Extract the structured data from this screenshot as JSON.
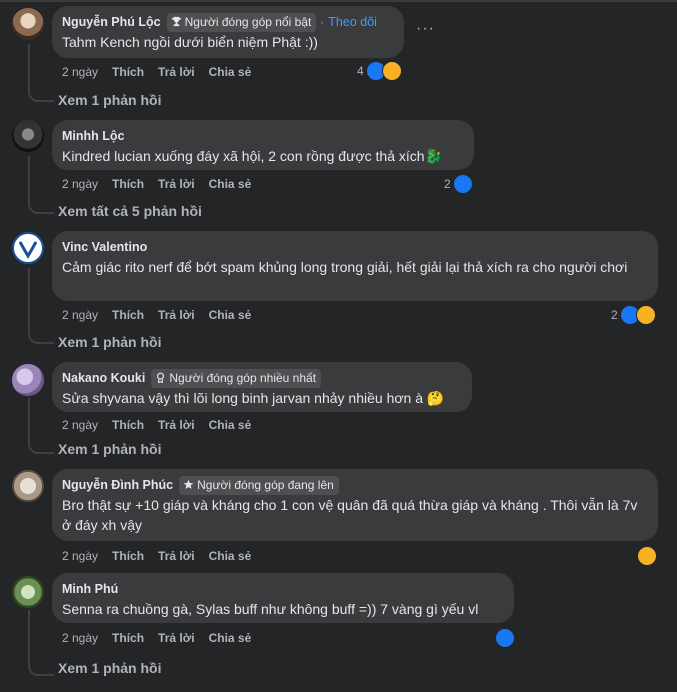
{
  "comments": [
    {
      "name": "Nguyễn Phú Lộc",
      "badge": "Người đóng góp nổi bật",
      "follow": "Theo dõi",
      "text": "Tahm Kench ngồi dưới biển niệm Phật :))",
      "time": "2 ngày",
      "like": "Thích",
      "reply": "Trả lời",
      "share": "Chia sẻ",
      "reaction_count": "4",
      "reactions": [
        "like",
        "haha"
      ],
      "replies": "Xem 1 phản hồi"
    },
    {
      "name": "Minhh Lộc",
      "text": "Kindred lucian xuống đáy xã hội, 2 con rồng được thả xích🐉",
      "time": "2 ngày",
      "like": "Thích",
      "reply": "Trả lời",
      "share": "Chia sẻ",
      "reaction_count": "2",
      "reactions": [
        "like"
      ],
      "replies": "Xem tất cả 5 phản hồi"
    },
    {
      "name": "Vinc Valentino",
      "text": "Cảm giác rito nerf để bớt spam khủng long trong giải, hết giải lại thả xích ra cho người chơi",
      "time": "2 ngày",
      "like": "Thích",
      "reply": "Trả lời",
      "share": "Chia sẻ",
      "reaction_count": "2",
      "reactions": [
        "like",
        "haha"
      ],
      "replies": "Xem 1 phản hồi"
    },
    {
      "name": "Nakano Kouki",
      "badge": "Người đóng góp nhiều nhất",
      "text": "Sửa shyvana vậy thì lõi long binh jarvan nhảy nhiều hơn à 🤔",
      "time": "2 ngày",
      "like": "Thích",
      "reply": "Trả lời",
      "share": "Chia sẻ",
      "replies": "Xem 1 phản hồi"
    },
    {
      "name": "Nguyễn Đình Phúc",
      "badge": "Người đóng góp đang lên",
      "text": "Bro thật sự +10 giáp và kháng cho 1 con vệ quân đã quá thừa giáp và kháng . Thôi vẫn là 7v ở đáy xh vậy",
      "time": "2 ngày",
      "like": "Thích",
      "reply": "Trả lời",
      "share": "Chia sẻ",
      "reactions": [
        "haha"
      ]
    },
    {
      "name": "Minh Phú",
      "text": "Senna ra chuồng gà, Sylas buff như không buff =)) 7 vàng gì yếu vl",
      "time": "2 ngày",
      "like": "Thích",
      "reply": "Trả lời",
      "share": "Chia sẻ",
      "reactions": [
        "like"
      ],
      "replies": "Xem 1 phản hồi"
    }
  ],
  "colors": {
    "background": "#242526",
    "bubble": "#3a3b3c",
    "link": "#4599ff",
    "like": "#1877f2",
    "haha": "#f7b125"
  },
  "icons": {
    "more": "more-options-icon"
  },
  "more_label": "···"
}
